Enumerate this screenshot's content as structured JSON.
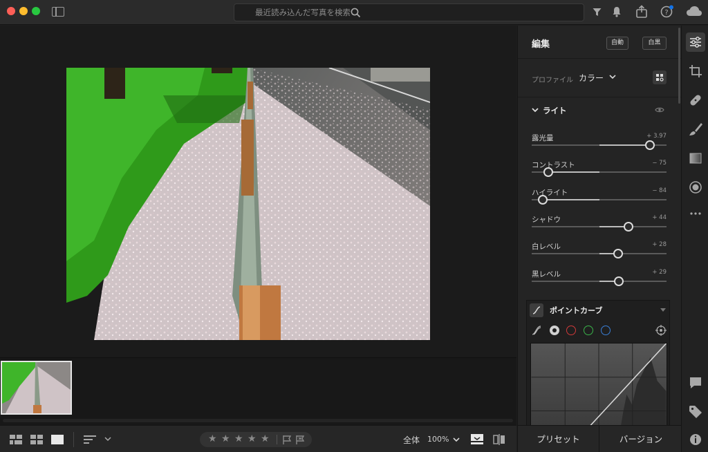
{
  "search": {
    "placeholder": "最近読み込んだ写真を検索"
  },
  "panel": {
    "title": "編集",
    "auto_label": "自動",
    "bw_label": "白黒",
    "profile_label": "プロファイル",
    "profile_value": "カラー",
    "light_title": "ライト",
    "sliders": [
      {
        "label": "露光量",
        "value": "+ 3.97",
        "level": 0.877
      },
      {
        "label": "コントラスト",
        "value": "− 75",
        "level": 0.125
      },
      {
        "label": "ハイライト",
        "value": "− 84",
        "level": 0.08
      },
      {
        "label": "シャドウ",
        "value": "+ 44",
        "level": 0.72
      },
      {
        "label": "白レベル",
        "value": "+ 28",
        "level": 0.64
      },
      {
        "label": "黒レベル",
        "value": "+ 29",
        "level": 0.645
      }
    ],
    "curve_title": "ポイントカーブ"
  },
  "bottombar": {
    "zoom_fit": "全体",
    "zoom_level": "100%"
  },
  "panel_bottom": {
    "presets": "プリセット",
    "versions": "バージョン"
  },
  "colors": {
    "accent_blue": "#1473e6",
    "red_channel": "#d23a3a",
    "green_channel": "#3ab54a",
    "blue_channel": "#3a7fd8"
  }
}
